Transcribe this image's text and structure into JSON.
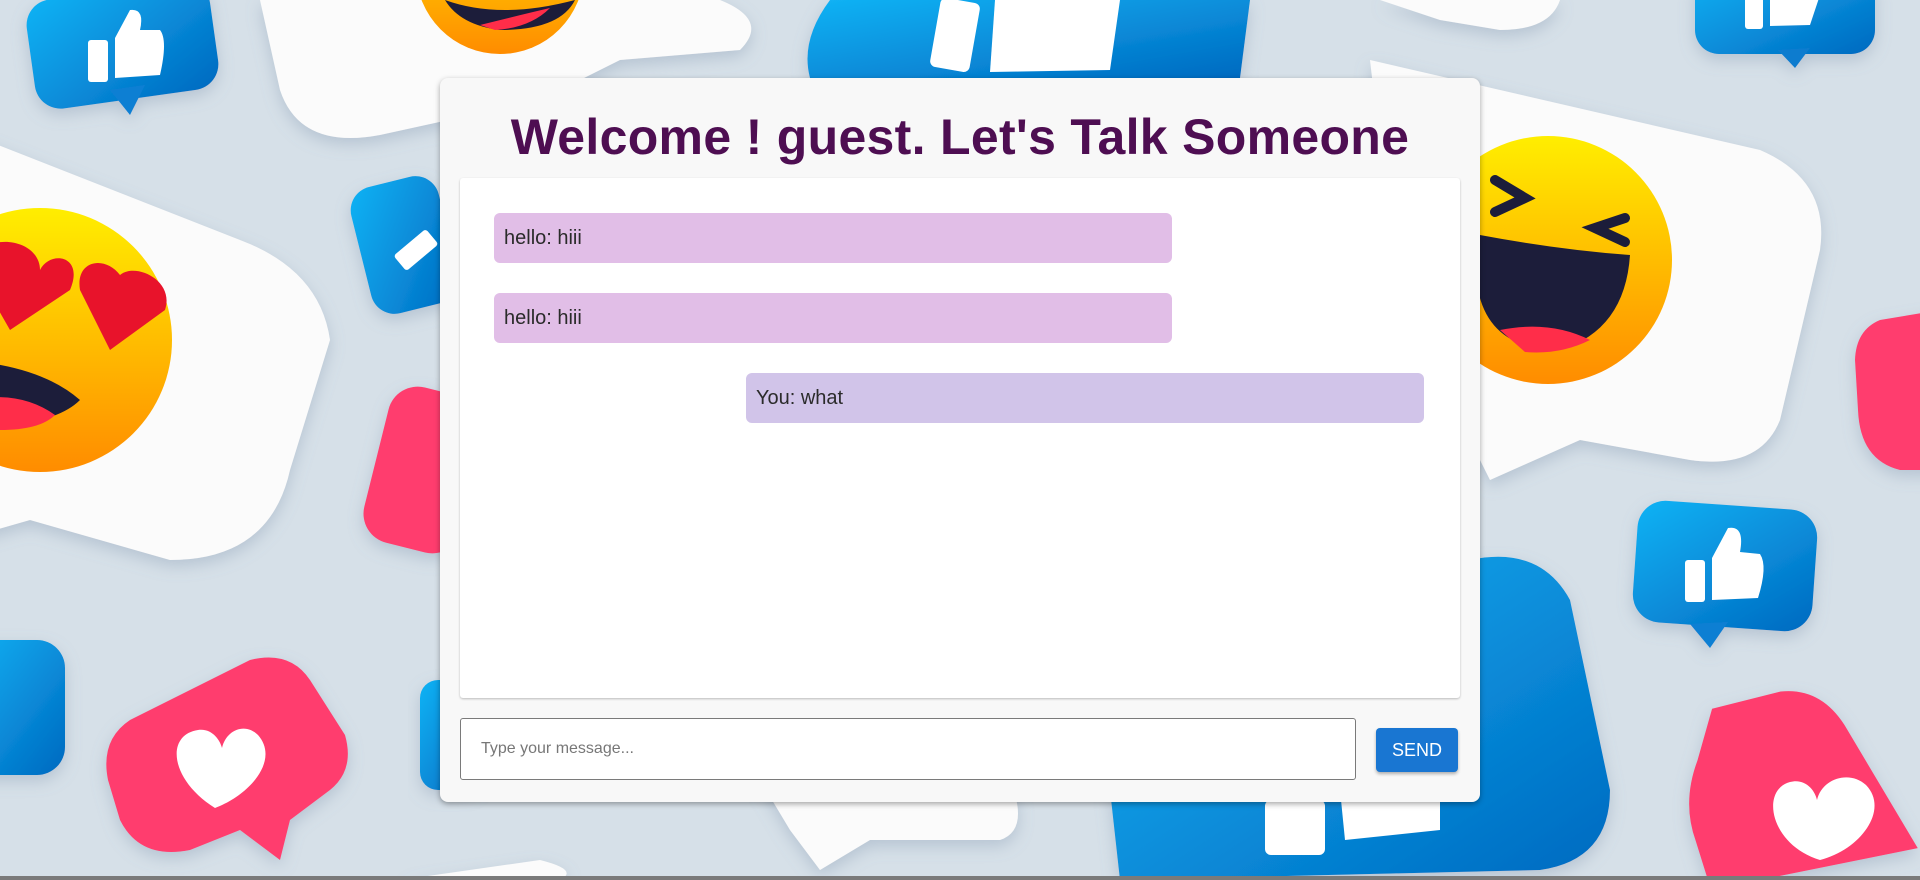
{
  "header": {
    "title": "Welcome ! guest. Let's Talk Someone"
  },
  "messages": [
    {
      "text": "hello: hiii",
      "sender": "other"
    },
    {
      "text": "hello: hiii",
      "sender": "other"
    },
    {
      "text": "You: what",
      "sender": "self"
    }
  ],
  "composer": {
    "placeholder": "Type your message...",
    "value": "",
    "send_label": "SEND"
  },
  "colors": {
    "title": "#4e0e52",
    "other_bubble": "#e1bee7",
    "self_bubble": "#d1c4e9",
    "send_button": "#1976d2",
    "thumbs_badge": "#0a8ee0",
    "heart_badge": "#ff3d6e",
    "emoji_face": "#ffb300"
  },
  "background_icons": [
    "thumbs-up-icon",
    "heart-icon",
    "laughing-emoji-icon",
    "heart-eyes-emoji-icon",
    "speech-bubble-icon"
  ]
}
